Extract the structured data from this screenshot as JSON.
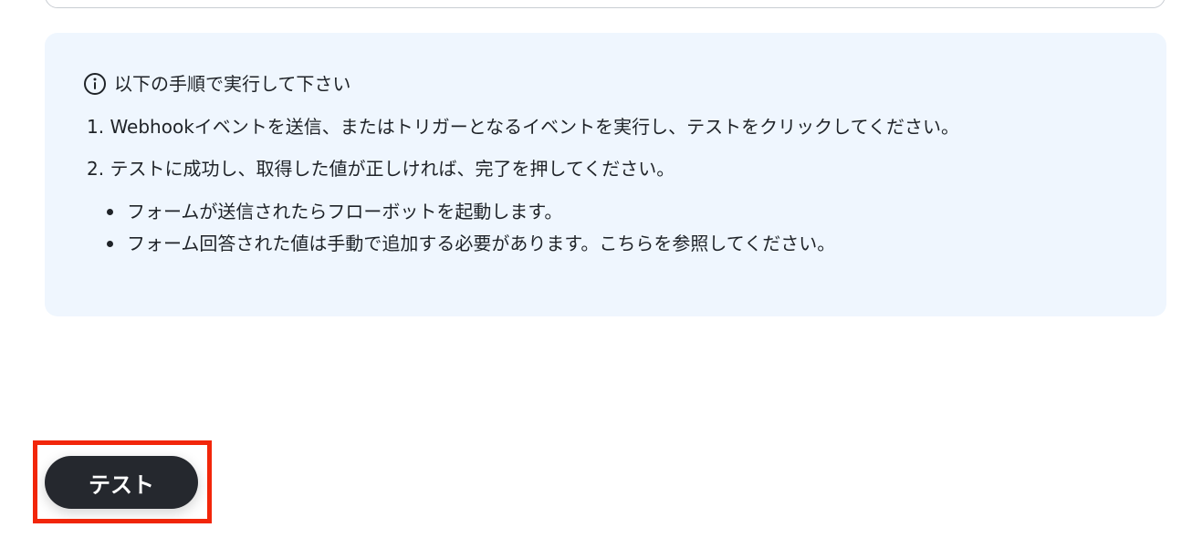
{
  "info_panel": {
    "title": "以下の手順で実行して下さい",
    "steps": [
      "1. Webhookイベントを送信、またはトリガーとなるイベントを実行し、テストをクリックしてください。",
      "2. テストに成功し、取得した値が正しければ、完了を押してください。"
    ],
    "bullets": [
      "フォームが送信されたらフローボットを起動します。",
      "フォーム回答された値は手動で追加する必要があります。こちらを参照してください。"
    ],
    "icon": "info-icon",
    "background_color": "#eff6fe"
  },
  "actions": {
    "test_label": "テスト",
    "button_color": "#25282e",
    "highlight_color": "#f2260a"
  }
}
